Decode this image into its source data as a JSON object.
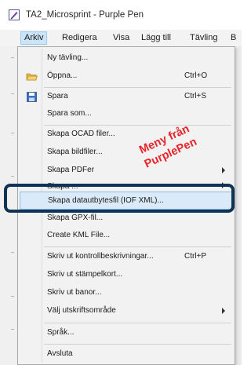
{
  "window": {
    "title": "TA2_Microsprint - Purple Pen"
  },
  "menubar": {
    "items": [
      "Arkiv",
      "Redigera",
      "Visa",
      "Lägg till",
      "Tävling",
      "B"
    ]
  },
  "menu": {
    "items": [
      {
        "label": "Ny tävling...",
        "shortcut": "",
        "icon": "",
        "submenu": false
      },
      {
        "label": "Öppna...",
        "shortcut": "Ctrl+O",
        "icon": "open-folder-icon",
        "submenu": false
      },
      {
        "label": "Spara",
        "shortcut": "Ctrl+S",
        "icon": "save-icon",
        "submenu": false
      },
      {
        "label": "Spara som...",
        "shortcut": "",
        "icon": "",
        "submenu": false
      },
      {
        "label": "Skapa OCAD filer...",
        "shortcut": "",
        "icon": "",
        "submenu": false
      },
      {
        "label": "Skapa bildfiler...",
        "shortcut": "",
        "icon": "",
        "submenu": false
      },
      {
        "label": "Skapa PDFer",
        "shortcut": "",
        "icon": "",
        "submenu": true
      },
      {
        "label": "Skapa ...",
        "shortcut": "",
        "icon": "",
        "submenu": false
      },
      {
        "label": "Skapa datautbytesfil (IOF XML)...",
        "shortcut": "",
        "icon": "",
        "submenu": false,
        "highlighted": true
      },
      {
        "label": "Skapa GPX-fil...",
        "shortcut": "",
        "icon": "",
        "submenu": false
      },
      {
        "label": "Create KML File...",
        "shortcut": "",
        "icon": "",
        "submenu": false
      },
      {
        "label": "Skriv ut kontrollbeskrivningar...",
        "shortcut": "Ctrl+P",
        "icon": "",
        "submenu": false
      },
      {
        "label": "Skriv ut stämpelkort...",
        "shortcut": "",
        "icon": "",
        "submenu": false
      },
      {
        "label": "Skriv ut banor...",
        "shortcut": "",
        "icon": "",
        "submenu": false
      },
      {
        "label": "Välj utskriftsområde",
        "shortcut": "",
        "icon": "",
        "submenu": true
      },
      {
        "label": "Språk...",
        "shortcut": "",
        "icon": "",
        "submenu": false
      },
      {
        "label": "Avsluta",
        "shortcut": "",
        "icon": "",
        "submenu": false
      }
    ]
  },
  "annotation": {
    "line1": "Meny från",
    "line2": "PurplePen",
    "color": "#e8232a",
    "box_color": "#0e3357"
  },
  "colors": {
    "highlight": "#dbeaf8",
    "menu_bg": "#f2f2f2",
    "menubar_active": "#cce4f7"
  }
}
